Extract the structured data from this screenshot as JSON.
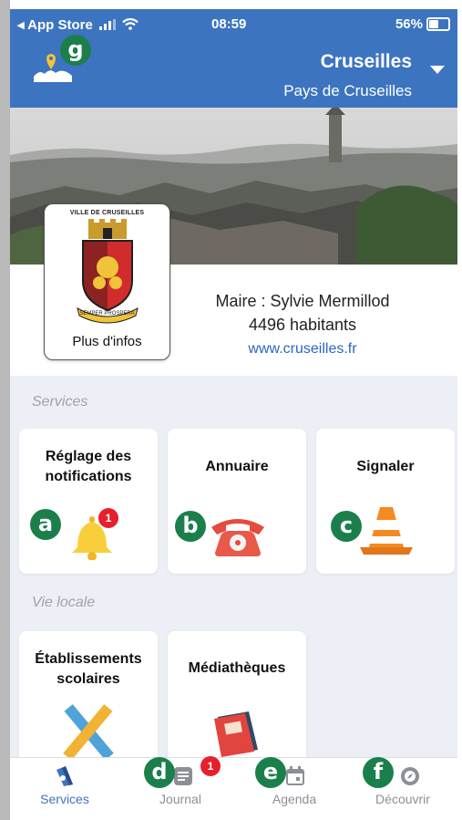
{
  "status_bar": {
    "back_label": "◂ App Store",
    "time": "08:59",
    "battery": "56%",
    "battery_level": 0.56
  },
  "header": {
    "city": "Cruseilles",
    "region": "Pays de Cruseilles",
    "app_logo_marker": "g"
  },
  "info": {
    "crest_caption": "VILLE DE CRUSEILLES",
    "crest_motto": "SEMPER PROSPERA",
    "more_info_button": "Plus d'infos",
    "mayor": "Maire : Sylvie Mermillod",
    "population": "4496 habitants",
    "website": "www.cruseilles.fr"
  },
  "sections": {
    "services": {
      "title": "Services",
      "cards": [
        {
          "label": "Réglage des notifications",
          "icon": "bell-icon",
          "badge": "1",
          "marker": "a"
        },
        {
          "label": "Annuaire",
          "icon": "telephone-icon",
          "marker": "b"
        },
        {
          "label": "Signaler",
          "icon": "traffic-cone-icon",
          "marker": "c"
        }
      ]
    },
    "vie_locale": {
      "title": "Vie locale",
      "cards": [
        {
          "label": "Établissements scolaires",
          "icon": "ruler-pencil-icon"
        },
        {
          "label": "Médiathèques",
          "icon": "book-icon"
        }
      ]
    }
  },
  "tabbar": {
    "items": [
      {
        "label": "Services",
        "icon": "services-icon",
        "active": true
      },
      {
        "label": "Journal",
        "icon": "journal-icon",
        "badge": "1",
        "marker": "d"
      },
      {
        "label": "Agenda",
        "icon": "calendar-icon",
        "marker": "e"
      },
      {
        "label": "Découvrir",
        "icon": "compass-icon",
        "marker": "f"
      }
    ]
  },
  "colors": {
    "header": "#3d74c0",
    "marker": "#1b7f4c",
    "badge": "#e5202c",
    "link": "#2a66c1"
  }
}
